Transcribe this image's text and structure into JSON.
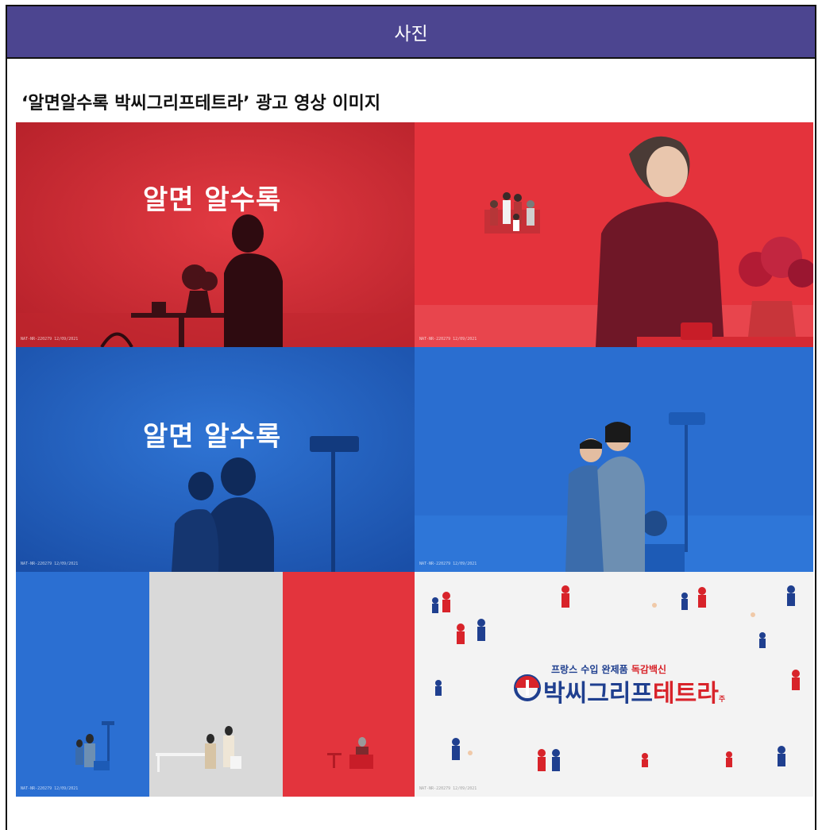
{
  "header": {
    "title": "사진"
  },
  "caption": "‘알면알수록 박씨그리프테트라’ 광고 영상 이미지",
  "tiles": {
    "t1_text": "알면 알수록",
    "t3_text": "알면 알수록",
    "footnote": "NAT-NR-220279 12/09/2021"
  },
  "brand": {
    "tagline_prefix": "프랑스 수입 완제품",
    "tagline_highlight": "독감백신",
    "name_blue": "박씨그리프",
    "name_red": "테트라",
    "superscript": "주"
  },
  "colors": {
    "header_bg": "#4c4590",
    "red_bg": "#e0313a",
    "blue_bg": "#2766c8",
    "brand_blue": "#1f3f8f",
    "brand_red": "#d8232a"
  }
}
